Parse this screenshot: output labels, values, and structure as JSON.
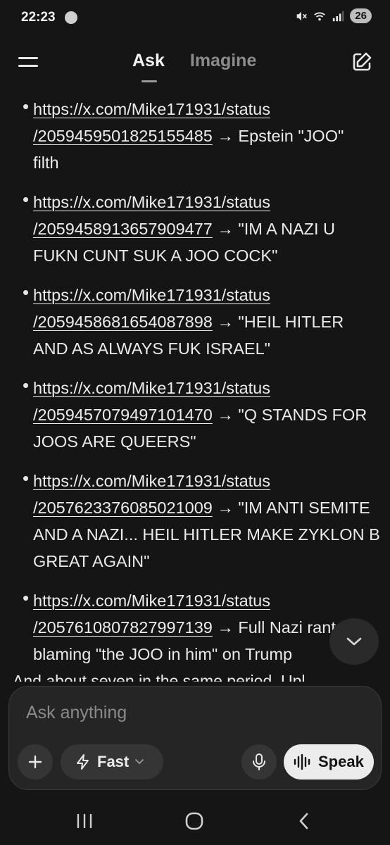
{
  "status_bar": {
    "time": "22:23",
    "battery": "26",
    "icons": [
      "app-badge-icon",
      "mute-icon",
      "wifi-6-icon",
      "signal-icon"
    ]
  },
  "header": {
    "menu_icon": "menu-icon",
    "tabs": [
      {
        "label": "Ask",
        "active": true
      },
      {
        "label": "Imagine",
        "active": false
      }
    ],
    "edit_icon": "edit-icon"
  },
  "content": {
    "items": [
      {
        "link_1": "https://x.com/Mike171931/status",
        "link_2": "/2059459501825155485",
        "rest_line_2": " → Epstein \"JOO\"",
        "line_3": "filth",
        "line_4": ""
      },
      {
        "link_1": "https://x.com/Mike171931/status",
        "link_2": "/2059458913657909477",
        "rest_line_2": " → \"IM A NAZI U",
        "line_3": "FUKN CUNT SUK A JOO COCK\"",
        "line_4": ""
      },
      {
        "link_1": "https://x.com/Mike171931/status",
        "link_2": "/2059458681654087898",
        "rest_line_2": " → \"HEIL HITLER",
        "line_3": "AND AS ALWAYS FUK ISRAEL\"",
        "line_4": ""
      },
      {
        "link_1": "https://x.com/Mike171931/status",
        "link_2": "/2059457079497101470",
        "rest_line_2": " → \"Q STANDS FOR",
        "line_3": "JOOS ARE QUEERS\"",
        "line_4": ""
      },
      {
        "link_1": "https://x.com/Mike171931/status",
        "link_2": "/2057623376085021009",
        "rest_line_2": " → \"IM ANTI SEMITE",
        "line_3": "AND A NAZI... HEIL HITLER MAKE ZYKLON B",
        "line_4": "GREAT AGAIN\""
      },
      {
        "link_1": "https://x.com/Mike171931/status",
        "link_2": "/2057610807827997139",
        "rest_line_2": " → Full Nazi rant",
        "line_3": "blaming \"the JOO in him\" on Trump",
        "line_4": ""
      }
    ],
    "partial_text": "And about seven in the same period. Upl"
  },
  "composer": {
    "placeholder": "Ask anything",
    "mode_label": "Fast",
    "speak_label": "Speak"
  },
  "nav_bar": {
    "buttons": [
      "recents-icon",
      "home-icon",
      "back-icon"
    ]
  }
}
